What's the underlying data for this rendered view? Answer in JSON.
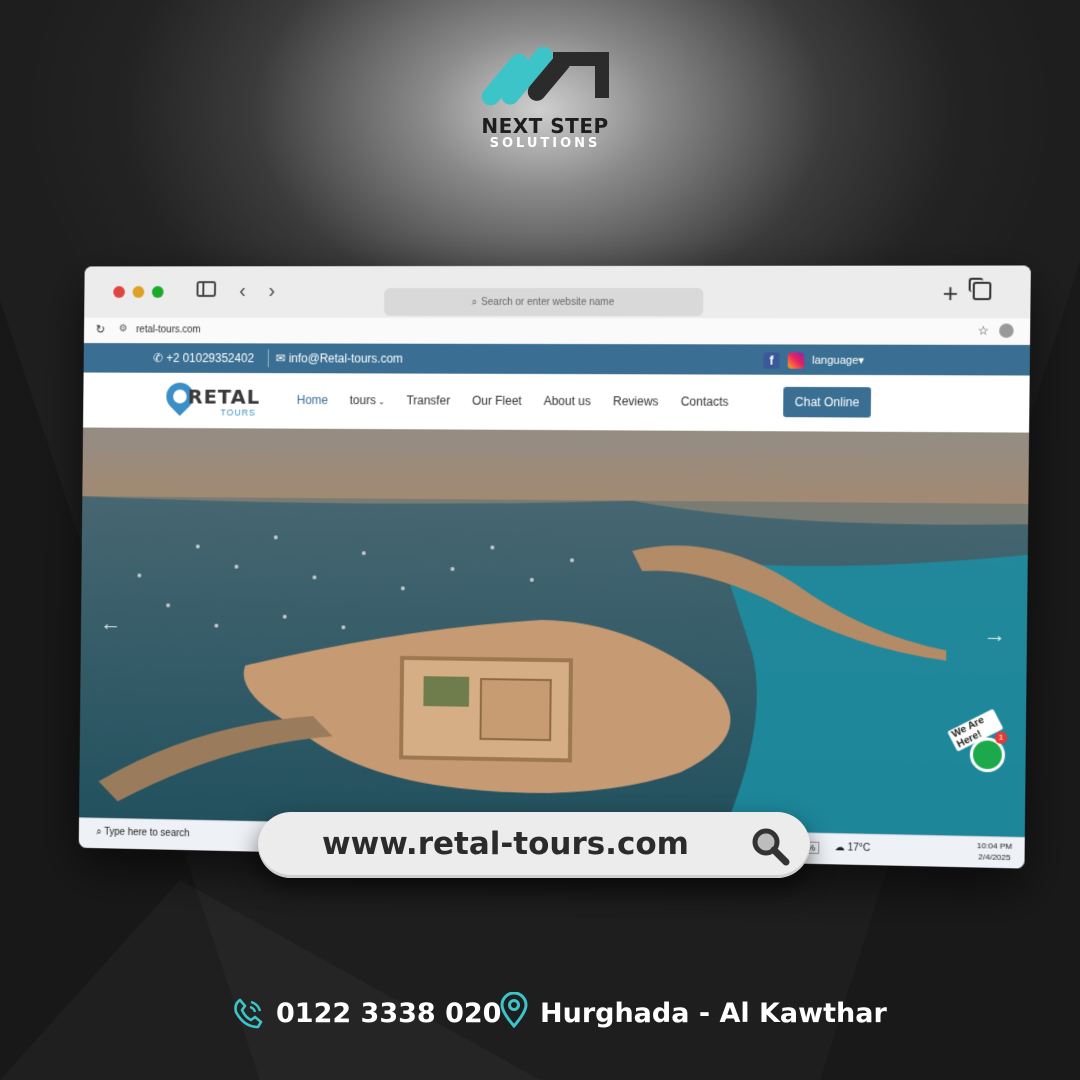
{
  "brand": {
    "name": "NEXT STEP",
    "sub": "SOLUTIONS",
    "colors": {
      "accent": "#3cc4c9",
      "dark": "#2b2b2b"
    }
  },
  "browser": {
    "omnibox_placeholder": "Search or enter website name",
    "address_url": "retal-tours.com",
    "icons": [
      "sidebar-icon",
      "back-icon",
      "forward-icon",
      "search-icon",
      "new-tab-icon",
      "tabs-overview-icon",
      "reload-icon",
      "site-settings-icon",
      "bookmark-star-icon"
    ]
  },
  "site": {
    "topbar": {
      "phone": "+2 01029352402",
      "email": "info@Retal-tours.com",
      "language": "language"
    },
    "logo": {
      "word": "RETAL",
      "sub": "TOURS"
    },
    "nav": [
      {
        "label": "Home",
        "active": true
      },
      {
        "label": "tours",
        "dropdown": true
      },
      {
        "label": "Transfer"
      },
      {
        "label": "Our Fleet"
      },
      {
        "label": "About us"
      },
      {
        "label": "Reviews"
      },
      {
        "label": "Contacts"
      }
    ],
    "cta": "Chat Online",
    "chat_widget": {
      "label": "We Are Here!",
      "badge": "1"
    },
    "colors": {
      "primary": "#3a6f93"
    }
  },
  "taskbar": {
    "search_placeholder": "Type here to search",
    "percent": "0%",
    "temperature": "17°C",
    "time": "10:04 PM",
    "date": "2/4/2025"
  },
  "overlay": {
    "url": "www.retal-tours.com"
  },
  "contact": {
    "phone": "0122 3338 020",
    "location": "Hurghada - Al Kawthar"
  }
}
